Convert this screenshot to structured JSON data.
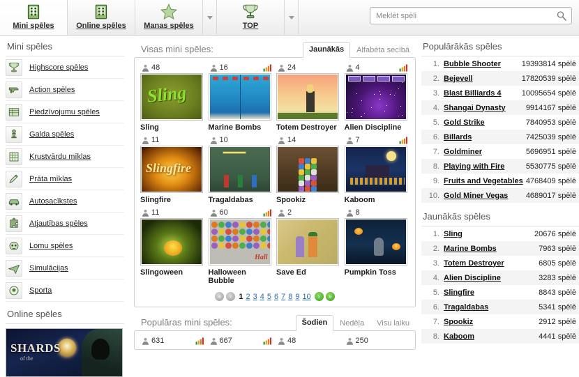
{
  "topnav": {
    "items": [
      {
        "label": "Mini spēles",
        "icon": "dice-building-icon",
        "active": true,
        "caret": false
      },
      {
        "label": "Online spēles",
        "icon": "dice-building-icon",
        "active": false,
        "caret": false
      },
      {
        "label": "Manas spēles",
        "icon": "star-icon",
        "active": false,
        "caret": true
      },
      {
        "label": "TOP",
        "icon": "trophy-icon",
        "active": false,
        "caret": true
      }
    ]
  },
  "search": {
    "placeholder": "Meklēt spēli",
    "value": "",
    "icon": "search-icon"
  },
  "sidebar": {
    "heading": "Mini spēles",
    "categories": [
      {
        "label": "Highscore spēles",
        "icon": "trophy-icon"
      },
      {
        "label": "Action spēles",
        "icon": "gun-icon"
      },
      {
        "label": "Piedzīvojumu spēles",
        "icon": "map-icon"
      },
      {
        "label": "Galda spēles",
        "icon": "chess-pawn-icon"
      },
      {
        "label": "Krustvārdu mīklas",
        "icon": "grid-icon"
      },
      {
        "label": "Prāta mīklas",
        "icon": "pencil-icon"
      },
      {
        "label": "Autosacīkstes",
        "icon": "car-icon"
      },
      {
        "label": "Atjautības spēles",
        "icon": "puzzle-icon"
      },
      {
        "label": "Lomu spēles",
        "icon": "mask-icon"
      },
      {
        "label": "Simulācijas",
        "icon": "plane-icon"
      },
      {
        "label": "Sporta",
        "icon": "soccer-ball-icon"
      }
    ],
    "online_heading": "Online spēles",
    "banner": {
      "title": "SHARDS",
      "subtitle": "of the"
    }
  },
  "main": {
    "panel_title": "Visas mini spēles:",
    "tabs": [
      {
        "label": "Jaunākās",
        "active": true
      },
      {
        "label": "Alfabēta secībā",
        "active": false
      }
    ],
    "games": [
      {
        "name": "Sling",
        "plays": "48",
        "has_bars": false,
        "art": "art-sling"
      },
      {
        "name": "Marine Bombs",
        "plays": "16",
        "has_bars": true,
        "art": "art-marine"
      },
      {
        "name": "Totem Destroyer",
        "plays": "24",
        "has_bars": false,
        "art": "art-totem"
      },
      {
        "name": "Alien Discipline",
        "plays": "4",
        "has_bars": true,
        "art": "art-alien"
      },
      {
        "name": "Slingfire",
        "plays": "11",
        "has_bars": false,
        "art": "art-slingfire"
      },
      {
        "name": "Tragaldabas",
        "plays": "10",
        "has_bars": false,
        "art": "art-traga"
      },
      {
        "name": "Spookiz",
        "plays": "14",
        "has_bars": false,
        "art": "art-spookiz"
      },
      {
        "name": "Kaboom",
        "plays": "7",
        "has_bars": true,
        "art": "art-kaboom"
      },
      {
        "name": "Slingoween",
        "plays": "11",
        "has_bars": false,
        "art": "art-slingoween"
      },
      {
        "name": "Halloween Bubble",
        "plays": "60",
        "has_bars": true,
        "art": "art-hbubble"
      },
      {
        "name": "Save Ed",
        "plays": "2",
        "has_bars": false,
        "art": "art-saveed"
      },
      {
        "name": "Pumpkin Toss",
        "plays": "8",
        "has_bars": false,
        "art": "art-pumpkin"
      }
    ],
    "pagination": {
      "first_icon": "first-page-icon",
      "prev_icon": "prev-page-icon",
      "pages": [
        "1",
        "2",
        "3",
        "4",
        "5",
        "6",
        "7",
        "8",
        "9",
        "10"
      ],
      "current": "1",
      "next_icon": "next-page-icon",
      "last_icon": "last-page-icon"
    },
    "bottom_panel": {
      "title": "Populāras mini spēles:",
      "tabs": [
        {
          "label": "Šodien",
          "active": true
        },
        {
          "label": "Nedēļa",
          "active": false
        },
        {
          "label": "Visu laiku",
          "active": false
        }
      ],
      "games": [
        {
          "plays": "631",
          "has_bars": true
        },
        {
          "plays": "667",
          "has_bars": true
        },
        {
          "plays": "48",
          "has_bars": false
        },
        {
          "plays": "250",
          "has_bars": false
        }
      ]
    }
  },
  "rightbar": {
    "popular": {
      "heading": "Populārākās spēles",
      "items": [
        {
          "rank": "1.",
          "name": "Bubble Shooter",
          "value": "19393814 spēlē"
        },
        {
          "rank": "2.",
          "name": "Bejevell",
          "value": "17820539 spēlē"
        },
        {
          "rank": "3.",
          "name": "Blast Billiards 4",
          "value": "10095654 spēlē"
        },
        {
          "rank": "4.",
          "name": "Shangai Dynasty",
          "value": "9914167 spēlē"
        },
        {
          "rank": "5.",
          "name": "Gold Strike",
          "value": "7840953 spēlē"
        },
        {
          "rank": "6.",
          "name": "Billards",
          "value": "7425039 spēlē"
        },
        {
          "rank": "7.",
          "name": "Goldminer",
          "value": "5696951 spēlē"
        },
        {
          "rank": "8.",
          "name": "Playing with Fire",
          "value": "5530775 spēlē"
        },
        {
          "rank": "9.",
          "name": "Fruits and Vegetables",
          "value": "4768409 spēlē"
        },
        {
          "rank": "10.",
          "name": "Gold Miner Vegas",
          "value": "4689017 spēlē"
        }
      ]
    },
    "newest": {
      "heading": "Jaunākās spēles",
      "items": [
        {
          "rank": "1.",
          "name": "Sling",
          "value": "20676 spēlē"
        },
        {
          "rank": "2.",
          "name": "Marine Bombs",
          "value": "7963 spēlē"
        },
        {
          "rank": "3.",
          "name": "Totem Destroyer",
          "value": "6805 spēlē"
        },
        {
          "rank": "4.",
          "name": "Alien Discipline",
          "value": "3283 spēlē"
        },
        {
          "rank": "5.",
          "name": "Slingfire",
          "value": "8843 spēlē"
        },
        {
          "rank": "6.",
          "name": "Tragaldabas",
          "value": "5341 spēlē"
        },
        {
          "rank": "7.",
          "name": "Spookiz",
          "value": "2912 spēlē"
        },
        {
          "rank": "8.",
          "name": "Kaboom",
          "value": "4441 spēlē"
        }
      ]
    }
  },
  "colors": {
    "accent_green": "#3a9e1e",
    "link_blue": "#2b6bb5",
    "panel_border": "#cfcfcf"
  }
}
